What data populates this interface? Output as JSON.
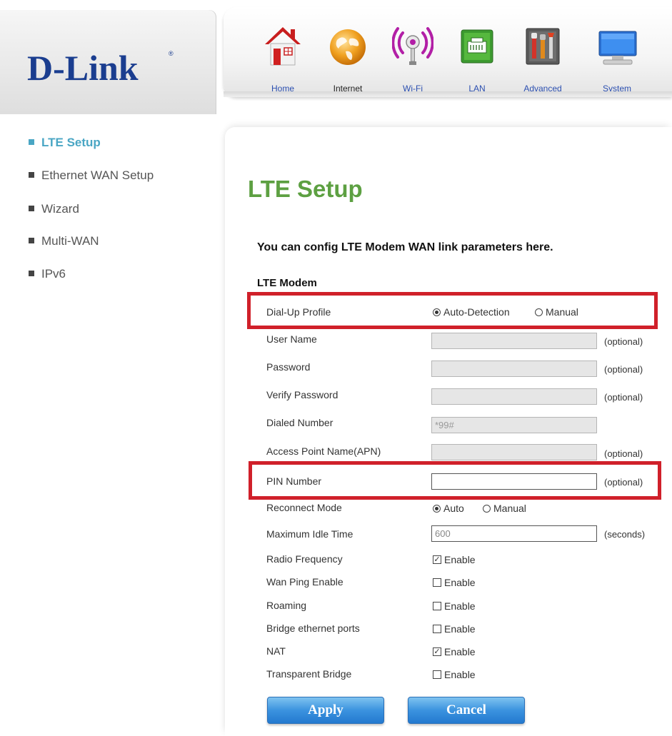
{
  "brand": {
    "logo": "D-Link",
    "logo_mark": "®"
  },
  "nav": [
    {
      "label": "Home",
      "icon": "house-icon"
    },
    {
      "label": "Internet",
      "icon": "globe-icon"
    },
    {
      "label": "Wi-Fi",
      "icon": "wifi-icon"
    },
    {
      "label": "LAN",
      "icon": "lan-port-icon"
    },
    {
      "label": "Advanced",
      "icon": "toolbox-icon"
    },
    {
      "label": "System",
      "icon": "monitor-icon"
    }
  ],
  "sidebar": {
    "items": [
      {
        "label": "LTE Setup",
        "active": true
      },
      {
        "label": "Ethernet WAN Setup"
      },
      {
        "label": "Wizard"
      },
      {
        "label": "Multi-WAN"
      },
      {
        "label": "IPv6"
      }
    ]
  },
  "main": {
    "title": "LTE Setup",
    "intro": "You can config LTE Modem WAN link parameters here.",
    "section": "LTE Modem",
    "dialup": {
      "label": "Dial-Up Profile",
      "options": [
        "Auto-Detection",
        "Manual"
      ],
      "selected": "Auto-Detection"
    },
    "fields": [
      {
        "label": "User Name",
        "value": "",
        "suffix": "(optional)"
      },
      {
        "label": "Password",
        "value": "",
        "suffix": "(optional)"
      },
      {
        "label": "Verify Password",
        "value": "",
        "suffix": "(optional)"
      },
      {
        "label": "Dialed Number",
        "value": "*99#",
        "suffix": ""
      },
      {
        "label": "Access Point Name(APN)",
        "value": "",
        "suffix": "(optional)"
      },
      {
        "label": "PIN Number",
        "value": "",
        "suffix": "(optional)"
      }
    ],
    "reconnect": {
      "label": "Reconnect Mode",
      "options": [
        "Auto",
        "Manual"
      ],
      "selected": "Auto"
    },
    "idle": {
      "label": "Maximum Idle Time",
      "value": "600",
      "suffix": "(seconds)"
    },
    "checks": [
      {
        "label": "Radio Frequency",
        "option": "Enable",
        "checked": true
      },
      {
        "label": "Wan Ping Enable",
        "option": "Enable",
        "checked": false
      },
      {
        "label": "Roaming",
        "option": "Enable",
        "checked": false
      },
      {
        "label": "Bridge ethernet ports",
        "option": "Enable",
        "checked": false
      },
      {
        "label": "NAT",
        "option": "Enable",
        "checked": true
      },
      {
        "label": "Transparent Bridge",
        "option": "Enable",
        "checked": false
      }
    ],
    "buttons": {
      "apply": "Apply",
      "cancel": "Cancel"
    }
  },
  "colors": {
    "title_green": "#5da042",
    "active_blue": "#4aa6c4",
    "highlight_red": "#d0202a",
    "button_blue": "#3b93df",
    "logo_blue": "#1a3d8f"
  }
}
